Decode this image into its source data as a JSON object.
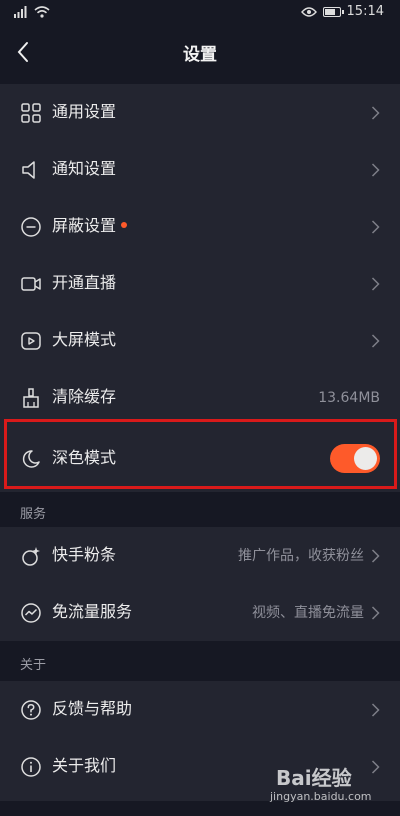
{
  "status_bar": {
    "time": "15:14",
    "battery_level": 0.8,
    "icons": [
      "signal-icon",
      "wifi-icon",
      "eye-icon",
      "battery-icon"
    ]
  },
  "nav": {
    "title": "设置",
    "back_icon": "chevron-left-icon"
  },
  "settings_group": {
    "items": [
      {
        "label": "通用设置",
        "icon": "grid-icon"
      },
      {
        "label": "通知设置",
        "icon": "speaker-icon"
      },
      {
        "label": "屏蔽设置",
        "icon": "minus-circle-icon",
        "has_dot": true
      },
      {
        "label": "开通直播",
        "icon": "video-camera-icon"
      },
      {
        "label": "大屏模式",
        "icon": "play-screen-icon"
      },
      {
        "label": "清除缓存",
        "icon": "broom-icon",
        "value": "13.64MB"
      },
      {
        "label": "深色模式",
        "icon": "moon-icon",
        "toggle_on": true
      }
    ]
  },
  "services": {
    "header": "服务",
    "items": [
      {
        "label": "快手粉条",
        "icon": "sparkle-icon",
        "value": "推广作品，收获粉丝"
      },
      {
        "label": "免流量服务",
        "icon": "trend-circle-icon",
        "value": "视频、直播免流量"
      }
    ]
  },
  "about": {
    "header": "关于",
    "items": [
      {
        "label": "反馈与帮助",
        "icon": "question-circle-icon"
      },
      {
        "label": "关于我们",
        "icon": "info-circle-icon"
      }
    ]
  },
  "colors": {
    "accent": "#fe5a2a",
    "highlight_border": "#d91a1a",
    "background": "#161823",
    "row_background": "#232530"
  },
  "watermark": {
    "logo": "Bai经验",
    "site": "jingyan.baidu.com"
  }
}
